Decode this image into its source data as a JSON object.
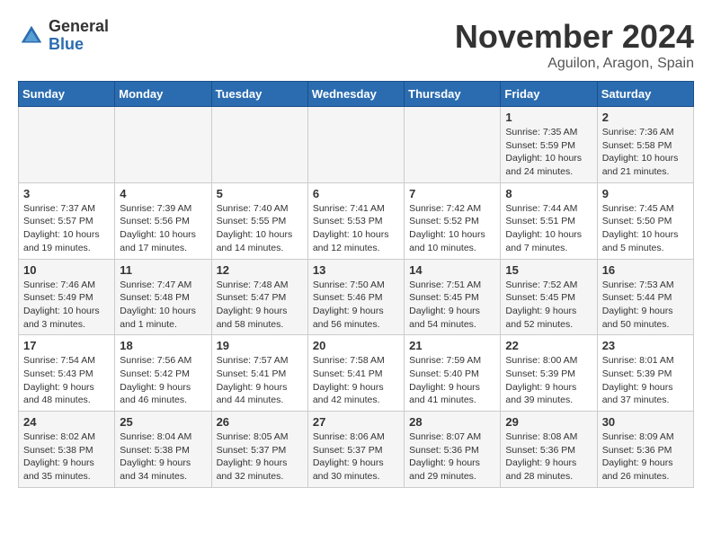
{
  "header": {
    "logo_general": "General",
    "logo_blue": "Blue",
    "title": "November 2024",
    "location": "Aguilon, Aragon, Spain"
  },
  "weekdays": [
    "Sunday",
    "Monday",
    "Tuesday",
    "Wednesday",
    "Thursday",
    "Friday",
    "Saturday"
  ],
  "weeks": [
    [
      {
        "day": "",
        "info": ""
      },
      {
        "day": "",
        "info": ""
      },
      {
        "day": "",
        "info": ""
      },
      {
        "day": "",
        "info": ""
      },
      {
        "day": "",
        "info": ""
      },
      {
        "day": "1",
        "info": "Sunrise: 7:35 AM\nSunset: 5:59 PM\nDaylight: 10 hours\nand 24 minutes."
      },
      {
        "day": "2",
        "info": "Sunrise: 7:36 AM\nSunset: 5:58 PM\nDaylight: 10 hours\nand 21 minutes."
      }
    ],
    [
      {
        "day": "3",
        "info": "Sunrise: 7:37 AM\nSunset: 5:57 PM\nDaylight: 10 hours\nand 19 minutes."
      },
      {
        "day": "4",
        "info": "Sunrise: 7:39 AM\nSunset: 5:56 PM\nDaylight: 10 hours\nand 17 minutes."
      },
      {
        "day": "5",
        "info": "Sunrise: 7:40 AM\nSunset: 5:55 PM\nDaylight: 10 hours\nand 14 minutes."
      },
      {
        "day": "6",
        "info": "Sunrise: 7:41 AM\nSunset: 5:53 PM\nDaylight: 10 hours\nand 12 minutes."
      },
      {
        "day": "7",
        "info": "Sunrise: 7:42 AM\nSunset: 5:52 PM\nDaylight: 10 hours\nand 10 minutes."
      },
      {
        "day": "8",
        "info": "Sunrise: 7:44 AM\nSunset: 5:51 PM\nDaylight: 10 hours\nand 7 minutes."
      },
      {
        "day": "9",
        "info": "Sunrise: 7:45 AM\nSunset: 5:50 PM\nDaylight: 10 hours\nand 5 minutes."
      }
    ],
    [
      {
        "day": "10",
        "info": "Sunrise: 7:46 AM\nSunset: 5:49 PM\nDaylight: 10 hours\nand 3 minutes."
      },
      {
        "day": "11",
        "info": "Sunrise: 7:47 AM\nSunset: 5:48 PM\nDaylight: 10 hours\nand 1 minute."
      },
      {
        "day": "12",
        "info": "Sunrise: 7:48 AM\nSunset: 5:47 PM\nDaylight: 9 hours\nand 58 minutes."
      },
      {
        "day": "13",
        "info": "Sunrise: 7:50 AM\nSunset: 5:46 PM\nDaylight: 9 hours\nand 56 minutes."
      },
      {
        "day": "14",
        "info": "Sunrise: 7:51 AM\nSunset: 5:45 PM\nDaylight: 9 hours\nand 54 minutes."
      },
      {
        "day": "15",
        "info": "Sunrise: 7:52 AM\nSunset: 5:45 PM\nDaylight: 9 hours\nand 52 minutes."
      },
      {
        "day": "16",
        "info": "Sunrise: 7:53 AM\nSunset: 5:44 PM\nDaylight: 9 hours\nand 50 minutes."
      }
    ],
    [
      {
        "day": "17",
        "info": "Sunrise: 7:54 AM\nSunset: 5:43 PM\nDaylight: 9 hours\nand 48 minutes."
      },
      {
        "day": "18",
        "info": "Sunrise: 7:56 AM\nSunset: 5:42 PM\nDaylight: 9 hours\nand 46 minutes."
      },
      {
        "day": "19",
        "info": "Sunrise: 7:57 AM\nSunset: 5:41 PM\nDaylight: 9 hours\nand 44 minutes."
      },
      {
        "day": "20",
        "info": "Sunrise: 7:58 AM\nSunset: 5:41 PM\nDaylight: 9 hours\nand 42 minutes."
      },
      {
        "day": "21",
        "info": "Sunrise: 7:59 AM\nSunset: 5:40 PM\nDaylight: 9 hours\nand 41 minutes."
      },
      {
        "day": "22",
        "info": "Sunrise: 8:00 AM\nSunset: 5:39 PM\nDaylight: 9 hours\nand 39 minutes."
      },
      {
        "day": "23",
        "info": "Sunrise: 8:01 AM\nSunset: 5:39 PM\nDaylight: 9 hours\nand 37 minutes."
      }
    ],
    [
      {
        "day": "24",
        "info": "Sunrise: 8:02 AM\nSunset: 5:38 PM\nDaylight: 9 hours\nand 35 minutes."
      },
      {
        "day": "25",
        "info": "Sunrise: 8:04 AM\nSunset: 5:38 PM\nDaylight: 9 hours\nand 34 minutes."
      },
      {
        "day": "26",
        "info": "Sunrise: 8:05 AM\nSunset: 5:37 PM\nDaylight: 9 hours\nand 32 minutes."
      },
      {
        "day": "27",
        "info": "Sunrise: 8:06 AM\nSunset: 5:37 PM\nDaylight: 9 hours\nand 30 minutes."
      },
      {
        "day": "28",
        "info": "Sunrise: 8:07 AM\nSunset: 5:36 PM\nDaylight: 9 hours\nand 29 minutes."
      },
      {
        "day": "29",
        "info": "Sunrise: 8:08 AM\nSunset: 5:36 PM\nDaylight: 9 hours\nand 28 minutes."
      },
      {
        "day": "30",
        "info": "Sunrise: 8:09 AM\nSunset: 5:36 PM\nDaylight: 9 hours\nand 26 minutes."
      }
    ]
  ]
}
